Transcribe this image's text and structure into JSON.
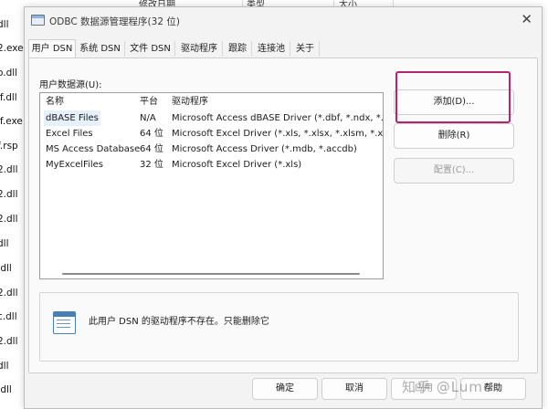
{
  "background": {
    "columns": [
      "修改日期",
      "类型",
      "大小"
    ],
    "files": [
      "dll",
      "2.exe",
      "o.dll",
      "if.dll",
      "if.exe",
      "f.rsp",
      "2.dll",
      "2.dll",
      "2.dll",
      "dll",
      ".dll",
      "2.dll",
      "c.dll",
      "2.dll",
      "dll",
      ".dll"
    ]
  },
  "dialog": {
    "title": "ODBC 数据源管理程序(32 位)",
    "close_glyph": "✕",
    "tabs": [
      "用户 DSN",
      "系统 DSN",
      "文件 DSN",
      "驱动程序",
      "跟踪",
      "连接池",
      "关于"
    ],
    "list_label": "用户数据源(U):",
    "columns": [
      "名称",
      "平台",
      "驱动程序"
    ],
    "rows": [
      {
        "name": "dBASE Files",
        "platform": "N/A",
        "driver": "Microsoft Access dBASE Driver (*.dbf, *.ndx, *.mdx)"
      },
      {
        "name": "Excel Files",
        "platform": "64 位",
        "driver": "Microsoft Excel Driver (*.xls, *.xlsx, *.xlsm, *.xlsb)"
      },
      {
        "name": "MS Access Database",
        "platform": "64 位",
        "driver": "Microsoft Access Driver (*.mdb, *.accdb)"
      },
      {
        "name": "MyExcelFiles",
        "platform": "32 位",
        "driver": "Microsoft Excel Driver (*.xls)"
      }
    ],
    "buttons": {
      "add": "添加(D)...",
      "remove": "删除(R)",
      "configure": "配置(C)..."
    },
    "info_text": "此用户 DSN 的驱动程序不存在。只能删除它",
    "footer": {
      "ok": "确定",
      "cancel": "取消",
      "apply": "应用",
      "help": "帮助"
    },
    "highlight_color": "#b0266f"
  },
  "watermark": "知乎 @Lumon"
}
